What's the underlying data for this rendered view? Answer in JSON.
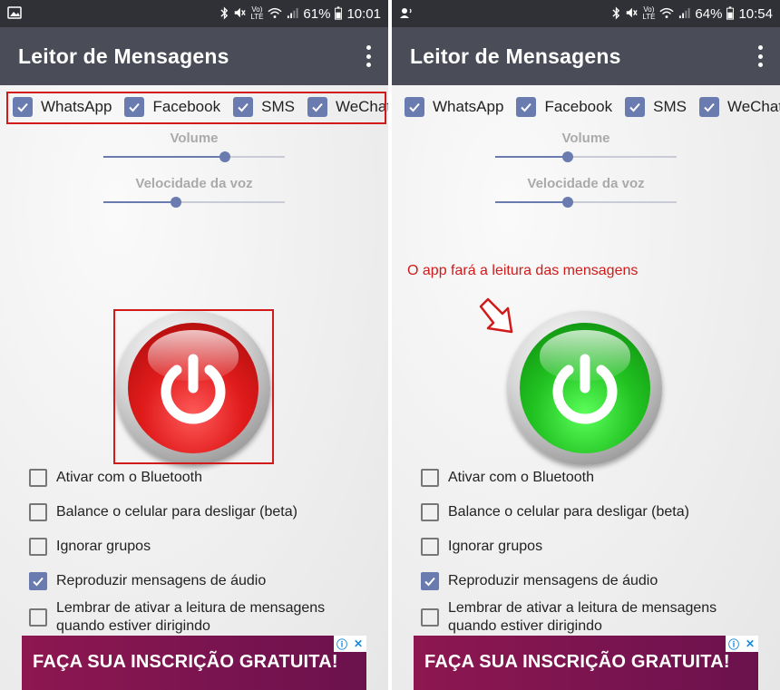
{
  "screens": {
    "left": {
      "status": {
        "battery": "61%",
        "time": "10:01"
      },
      "title": "Leitor de Mensagens",
      "apps": [
        "WhatsApp",
        "Facebook",
        "SMS",
        "WeChat"
      ],
      "volume_label": "Volume",
      "volume_level_pct": 67,
      "speed_label": "Velocidade da voz",
      "speed_level_pct": 40,
      "power_state": "off",
      "options": [
        {
          "label": "Ativar com o Bluetooth",
          "checked": false
        },
        {
          "label": "Balance o celular para desligar (beta)",
          "checked": false
        },
        {
          "label": "Ignorar grupos",
          "checked": false
        },
        {
          "label": "Reproduzir mensagens de áudio",
          "checked": true
        },
        {
          "label": "Lembrar de ativar a leitura de mensagens",
          "label2": "quando estiver dirigindo",
          "checked": false
        }
      ],
      "ad_text": "FAÇA SUA INSCRIÇÃO GRATUITA!"
    },
    "right": {
      "status": {
        "battery": "64%",
        "time": "10:54"
      },
      "title": "Leitor de Mensagens",
      "apps": [
        "WhatsApp",
        "Facebook",
        "SMS",
        "WeChat"
      ],
      "volume_label": "Volume",
      "volume_level_pct": 40,
      "speed_label": "Velocidade da voz",
      "speed_level_pct": 40,
      "power_state": "on",
      "annotation": "O app fará a leitura das mensagens",
      "options": [
        {
          "label": "Ativar com o Bluetooth",
          "checked": false
        },
        {
          "label": "Balance o celular para desligar (beta)",
          "checked": false
        },
        {
          "label": "Ignorar grupos",
          "checked": false
        },
        {
          "label": "Reproduzir mensagens de áudio",
          "checked": true
        },
        {
          "label": "Lembrar de ativar a leitura de mensagens",
          "label2": "quando estiver dirigindo",
          "checked": false
        }
      ],
      "ad_text": "FAÇA SUA INSCRIÇÃO GRATUITA!"
    }
  },
  "status_icons": [
    "bluetooth-icon",
    "mute-icon",
    "volte-icon",
    "wifi-icon",
    "signal-icon",
    "battery-icon"
  ],
  "colors": {
    "appbar": "#4a4c57",
    "statusbar": "#2f3136",
    "accent": "#6a7bb0",
    "highlight": "#d11a1a",
    "ad_bg": "#8e1750"
  }
}
